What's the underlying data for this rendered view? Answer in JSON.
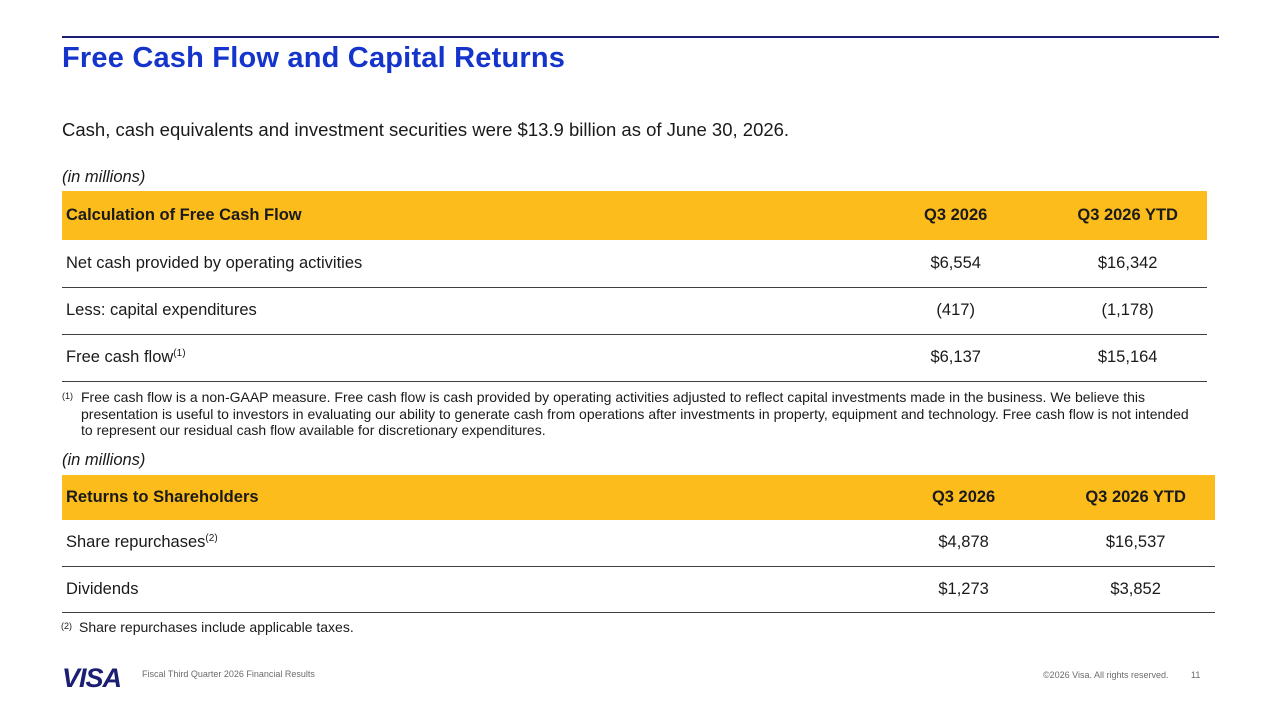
{
  "slide": {
    "title": "Free Cash Flow and Capital Returns",
    "subtitle": "Cash, cash equivalents and investment securities were $13.9 billion as of June 30, 2026.",
    "units_label": "(in millions)"
  },
  "fcf_table": {
    "header": {
      "label": "Calculation of Free Cash Flow",
      "col1": "Q3 2026",
      "col2": "Q3 2026 YTD"
    },
    "rows": [
      {
        "label": "Net cash provided by operating activities",
        "ref": "",
        "q3": "$6,554",
        "ytd": "$16,342"
      },
      {
        "label": "Less: capital expenditures",
        "ref": "",
        "q3": "(417)",
        "ytd": "(1,178)"
      },
      {
        "label": "Free cash flow",
        "ref": "(1)",
        "q3": "$6,137",
        "ytd": "$15,164"
      }
    ]
  },
  "footnote1": {
    "marker": "(1)",
    "text": "Free cash flow is a non-GAAP measure. Free cash flow is cash provided by operating activities adjusted to reflect capital investments made in the business. We believe this presentation is useful to investors in evaluating our ability to generate cash from operations after investments in property, equipment and technology. Free cash flow is not intended to represent our residual cash flow available for discretionary expenditures."
  },
  "returns_table": {
    "header": {
      "label": "Returns to Shareholders",
      "col1": "Q3 2026",
      "col2": "Q3 2026 YTD"
    },
    "rows": [
      {
        "label": "Share repurchases",
        "ref": "(2)",
        "q3": "$4,878",
        "ytd": "$16,537"
      },
      {
        "label": "Dividends",
        "ref": "",
        "q3": "$1,273",
        "ytd": "$3,852"
      }
    ]
  },
  "footnote2": {
    "marker": "(2)",
    "text": "Share repurchases include applicable taxes."
  },
  "footer": {
    "logo_text": "VISA",
    "left_text": "Fiscal Third Quarter 2026 Financial Results",
    "copyright": "©2026 Visa. All rights reserved.",
    "page_number": "11"
  },
  "colors": {
    "title_blue": "#1434cb",
    "header_gold": "#fcbc1b",
    "logo_navy": "#1a1f71"
  }
}
